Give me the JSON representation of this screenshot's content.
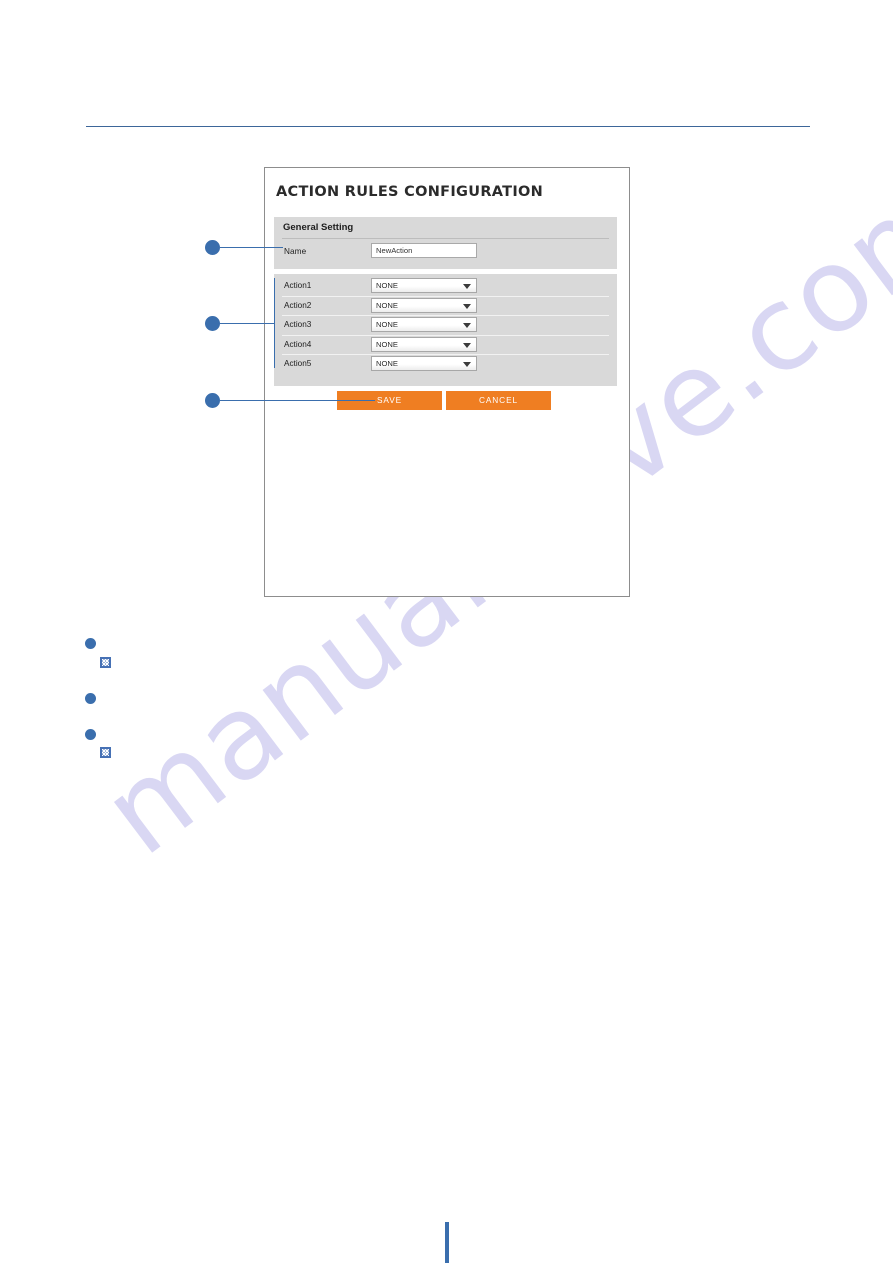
{
  "document": {
    "watermark_text": "manualshive.com",
    "accent_blue": "#3a6ead",
    "accent_orange": "#ef7e22",
    "panel_gray": "#d9d9d9"
  },
  "ui_panel": {
    "title": "ACTION RULES CONFIGURATION",
    "general_setting": {
      "heading": "General Setting",
      "name_label": "Name",
      "name_value": "NewAction",
      "name_placeholder": "NewAction"
    },
    "actions": [
      {
        "label": "Action1",
        "value": "NONE"
      },
      {
        "label": "Action2",
        "value": "NONE"
      },
      {
        "label": "Action3",
        "value": "NONE"
      },
      {
        "label": "Action4",
        "value": "NONE"
      },
      {
        "label": "Action5",
        "value": "NONE"
      }
    ],
    "buttons": {
      "save": "SAVE",
      "cancel": "CANCEL"
    }
  },
  "callouts": [
    {
      "id": "callout-1",
      "target": "name-field"
    },
    {
      "id": "callout-2",
      "target": "action-list"
    },
    {
      "id": "callout-3",
      "target": "save-button"
    }
  ],
  "body_markers": [
    {
      "id": "body-bullet-1",
      "icon": "broken-image-glyph"
    },
    {
      "id": "body-bullet-2",
      "icon": null
    },
    {
      "id": "body-bullet-3",
      "icon": "broken-image-glyph"
    }
  ]
}
